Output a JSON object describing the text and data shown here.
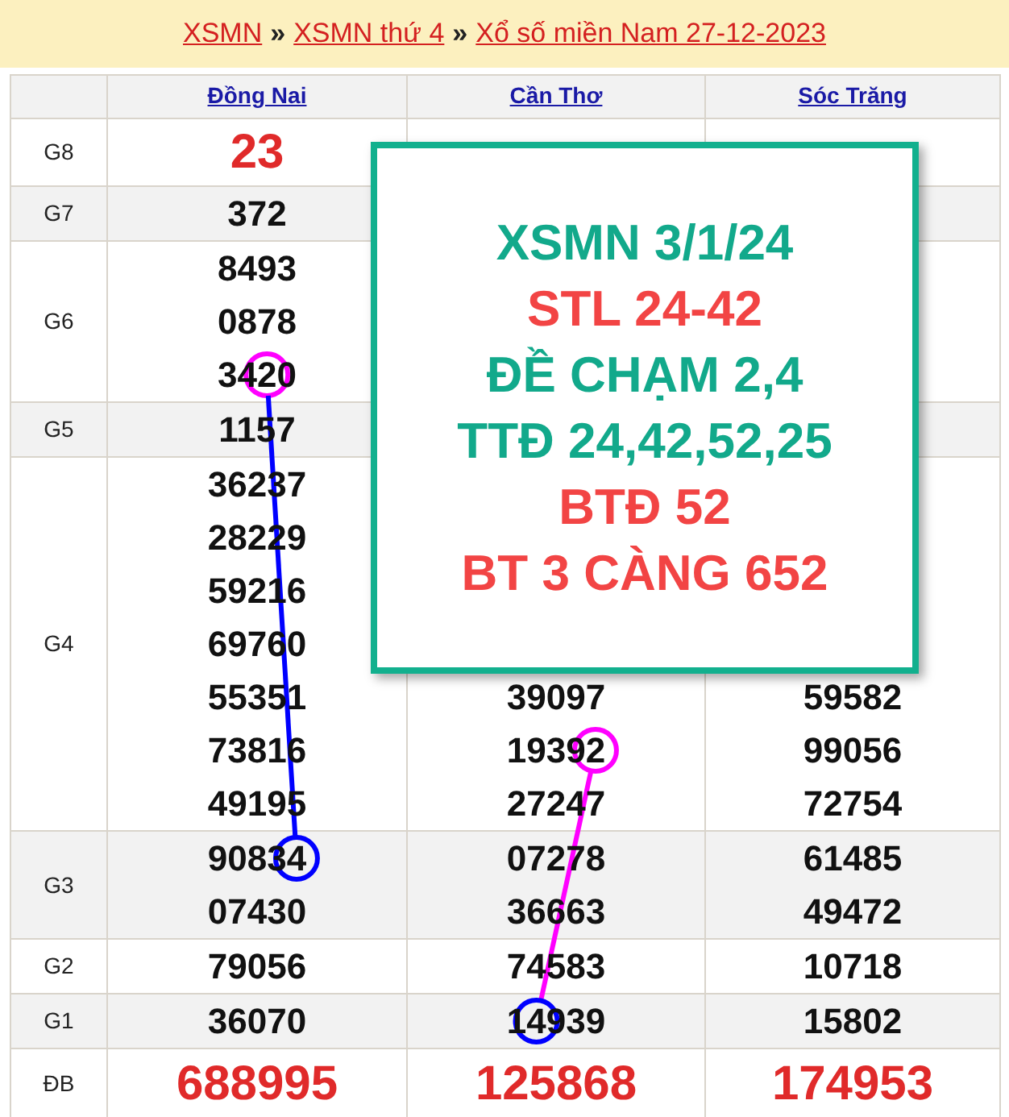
{
  "breadcrumb": [
    {
      "kind": "link",
      "text": "XSMN"
    },
    {
      "kind": "separator",
      "text": "»"
    },
    {
      "kind": "link",
      "text": "XSMN thứ 4"
    },
    {
      "kind": "separator",
      "text": "»"
    },
    {
      "kind": "link",
      "text": "Xổ số miền Nam 27-12-2023"
    }
  ],
  "provinces": [
    "Đồng Nai",
    "Cần Thơ",
    "Sóc Trăng"
  ],
  "rows": [
    {
      "prize": "G8",
      "kind": "big",
      "cells": [
        {
          "numbers": [
            {
              "value": "23"
            }
          ]
        },
        {},
        {}
      ]
    },
    {
      "prize": "G7",
      "kind": "normal",
      "cells": [
        {
          "numbers": [
            {
              "value": "372"
            }
          ]
        },
        {},
        {}
      ]
    },
    {
      "prize": "G6",
      "kind": "normal",
      "cells": [
        {
          "numbers": [
            {
              "value": "8493"
            },
            {
              "value": "0878"
            },
            {
              "value": "3420",
              "circle": {
                "color": "#ff00ff",
                "kind": "third-digit"
              },
              "line": {
                "color": "#0000ff"
              }
            }
          ]
        },
        {},
        {}
      ]
    },
    {
      "prize": "G5",
      "kind": "normal",
      "cells": [
        {
          "numbers": [
            {
              "value": "1157"
            }
          ]
        },
        {},
        {}
      ]
    },
    {
      "prize": "G4",
      "kind": "normal",
      "cells": [
        {
          "numbers": [
            {
              "value": "36237"
            },
            {
              "value": "28229"
            },
            {
              "value": "59216"
            },
            {
              "value": "69760"
            },
            {
              "value": "55351"
            },
            {
              "value": "73816"
            },
            {
              "value": "49195"
            }
          ]
        },
        {
          "numbers": [
            {
              "value": "39097"
            },
            {
              "value": "19392",
              "circle": {
                "color": "#ff00ff",
                "kind": "fifth-digit"
              },
              "line": {
                "color": "#ff00ff"
              }
            },
            {
              "value": "27247"
            }
          ]
        },
        {
          "numbers": [
            {
              "value": "59582"
            },
            {
              "value": "99056"
            },
            {
              "value": "72754"
            }
          ]
        }
      ]
    },
    {
      "prize": "G3",
      "kind": "normal",
      "cells": [
        {
          "numbers": [
            {
              "value": "90834",
              "circle": {
                "color": "#0000ff",
                "kind": "fifth-digit"
              }
            },
            {
              "value": "07430"
            }
          ]
        },
        {
          "numbers": [
            {
              "value": "07278"
            },
            {
              "value": "36663"
            }
          ]
        },
        {
          "numbers": [
            {
              "value": "61485"
            },
            {
              "value": "49472"
            }
          ]
        }
      ]
    },
    {
      "prize": "G2",
      "kind": "normal",
      "cells": [
        {
          "numbers": [
            {
              "value": "79056"
            }
          ]
        },
        {
          "numbers": [
            {
              "value": "74583"
            }
          ]
        },
        {
          "numbers": [
            {
              "value": "10718"
            }
          ]
        }
      ]
    },
    {
      "prize": "G1",
      "kind": "normal",
      "cells": [
        {
          "numbers": [
            {
              "value": "36070"
            }
          ]
        },
        {
          "numbers": [
            {
              "value": "14939",
              "circle": {
                "color": "#0000ff",
                "kind": "second-digit"
              }
            }
          ]
        },
        {
          "numbers": [
            {
              "value": "15802"
            }
          ]
        }
      ]
    },
    {
      "prize": "ĐB",
      "kind": "big",
      "cells": [
        {
          "numbers": [
            {
              "value": "688995"
            }
          ]
        },
        {
          "numbers": [
            {
              "value": "125868"
            }
          ]
        },
        {
          "numbers": [
            {
              "value": "174953"
            }
          ]
        }
      ]
    }
  ],
  "notice": {
    "lines": [
      {
        "text": "XSMN 3/1/24",
        "color": "#12a98b"
      },
      {
        "text": "STL 24-42",
        "color": "#f24444"
      },
      {
        "text": "ĐỀ CHẠM 2,4",
        "color": "#12a98b"
      },
      {
        "text": "TTĐ 24,42,52,25",
        "color": "#12a98b"
      },
      {
        "text": "BTĐ 52",
        "color": "#f24444"
      },
      {
        "text": "BT 3 CÀNG 652",
        "color": "#f24444"
      }
    ]
  }
}
